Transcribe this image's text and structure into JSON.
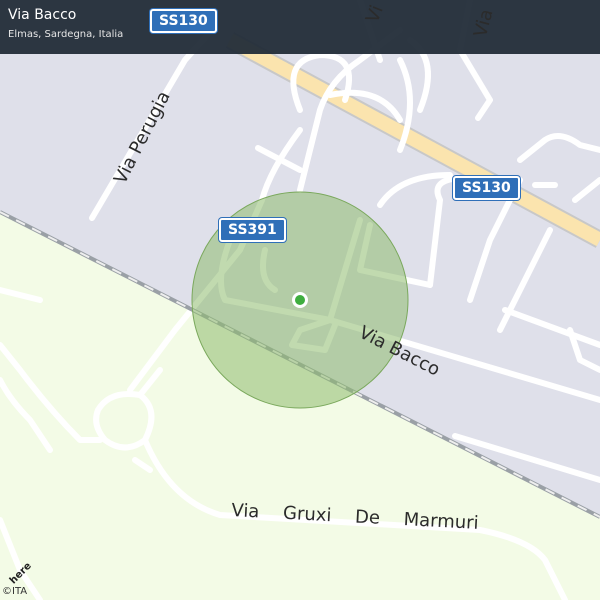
{
  "header": {
    "title": "Via Bacco",
    "subtitle": "Elmas, Sardegna, Italia"
  },
  "map": {
    "road_badges": [
      "SS130",
      "SS130",
      "SS391"
    ],
    "street_labels": [
      "Via Perugia",
      "Via Bacco",
      "Via Gruxi De Marmuri",
      "Vi",
      "Via"
    ],
    "logo_text": "here",
    "attribution": "©ITA",
    "colors": {
      "urban": "#dfe0ea",
      "green": "#f3fbe6",
      "road": "#ffffff",
      "highway": "#fbe4ae",
      "railway": "#7a7f86",
      "accuracy_circle": "#8ebc6e",
      "location_dot": "#3fae3f",
      "badge": "#2f6fb8"
    }
  }
}
